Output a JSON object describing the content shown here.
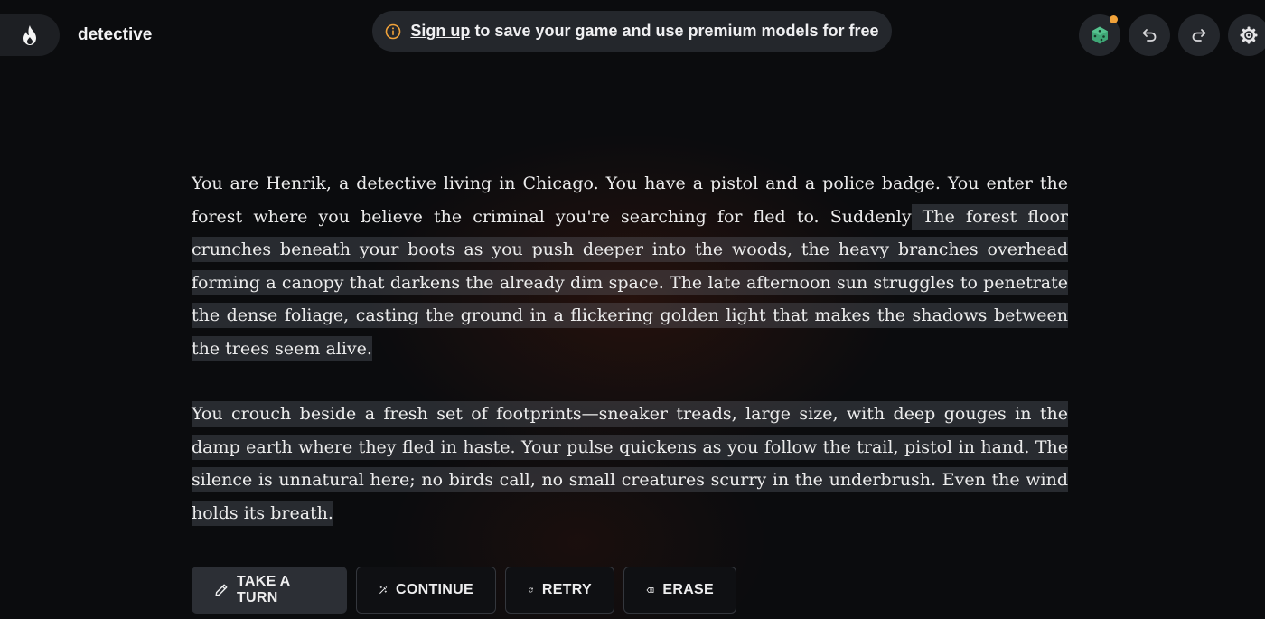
{
  "header": {
    "logo_icon": "flame-icon",
    "title": "detective",
    "banner": {
      "icon": "info-icon",
      "link_text": "Sign up",
      "text": "to save your game and use premium models for free",
      "accent_color": "#f2a33a"
    },
    "toolbar": [
      {
        "name": "model-dice-button",
        "icon": "dice-icon",
        "has_notification": true
      },
      {
        "name": "undo-button",
        "icon": "undo-icon"
      },
      {
        "name": "redo-button",
        "icon": "redo-icon"
      },
      {
        "name": "settings-button",
        "icon": "gear-icon"
      }
    ]
  },
  "story": {
    "intro": "You are Henrik, a detective living in Chicago. You have a pistol and a police badge. You enter the forest where you believe the criminal you're searching for fled to. Suddenly",
    "continuation_1": " The forest floor crunches beneath your boots as you push deeper into the woods, the heavy branches overhead forming a canopy that darkens the already dim space. The late afternoon sun struggles to penetrate the dense foliage, casting the ground in a flickering golden light that makes the shadows between the trees seem alive.",
    "continuation_2": "You crouch beside a fresh set of footprints—sneaker treads, large size, with deep gouges in the damp earth where they fled in haste. Your pulse quickens as you follow the trail, pistol in hand. The silence is unnatural here; no birds call, no small creatures scurry in the underbrush. Even the wind holds its breath."
  },
  "actions": {
    "take_turn": "TAKE A TURN",
    "continue": "CONTINUE",
    "retry": "RETRY",
    "erase": "ERASE"
  }
}
